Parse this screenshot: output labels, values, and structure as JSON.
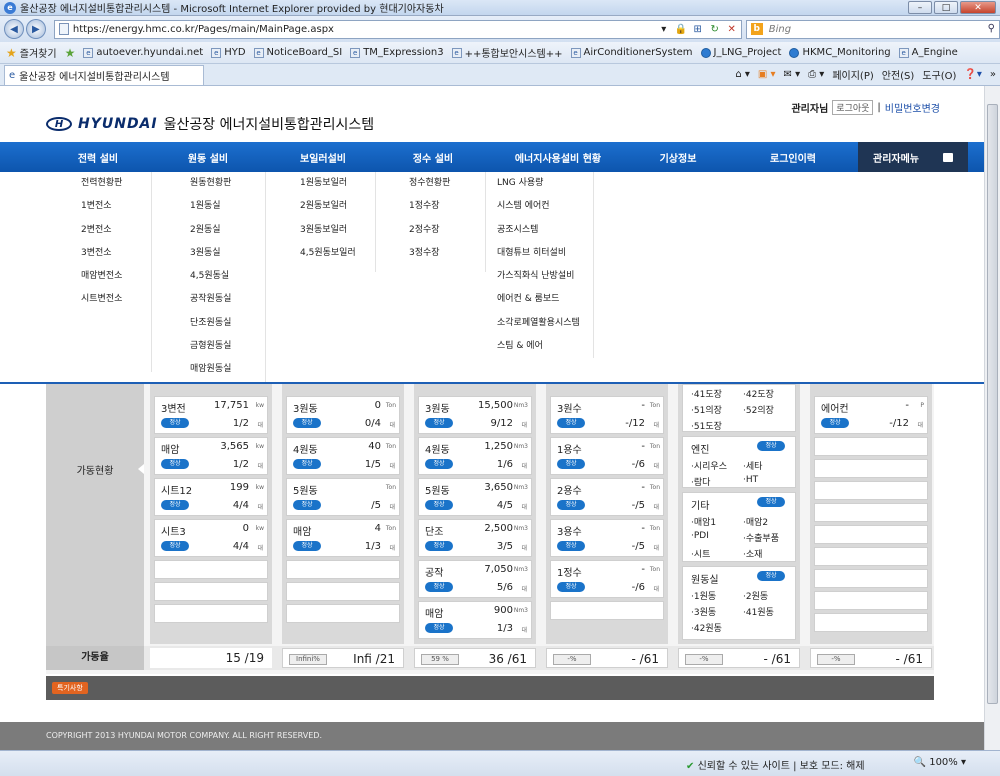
{
  "browser": {
    "title": "울산공장 에너지설비통합관리시스템 - Microsoft Internet Explorer provided by 현대기아자동차",
    "url": "https://energy.hmc.co.kr/Pages/main/MainPage.aspx",
    "search_placeholder": "Bing",
    "favorites_label": "즐겨찾기",
    "favorites": [
      "autoever.hyundai.net",
      "HYD",
      "NoticeBoard_SI",
      "TM_Expression3",
      "++통합보안시스템++",
      "AirConditionerSystem",
      "J_LNG_Project",
      "HKMC_Monitoring",
      "A_Engine"
    ],
    "tab_title": "울산공장 에너지설비통합관리시스템",
    "cmd": {
      "page": "페이지(P)",
      "safety": "안전(S)",
      "tools": "도구(O)"
    },
    "status_text": "신뢰할 수 있는 사이트 | 보호 모드: 해제",
    "zoom": "100%"
  },
  "header": {
    "brand": "HYUNDAI",
    "system_name": "울산공장 에너지설비통합관리시스템",
    "user": "관리자님",
    "logout": "로그아웃",
    "change_pw": "비밀번호변경"
  },
  "menu": [
    "전력 설비",
    "원동 설비",
    "보일러설비",
    "정수 설비",
    "에너지사용설비 현황",
    "기상정보",
    "로그인이력",
    "관리자메뉴"
  ],
  "dropdown": [
    [
      "전력현황판",
      "1변전소",
      "2변전소",
      "3변전소",
      "매암변전소",
      "시트변전소"
    ],
    [
      "원동현황판",
      "1원동실",
      "2원동실",
      "3원동실",
      "4,5원동실",
      "공작원동실",
      "단조원동실",
      "금형원동실",
      "매암원동실"
    ],
    [
      "1원동보일러",
      "2원동보일러",
      "3원동보일러",
      "4,5원동보일러"
    ],
    [
      "정수현황판",
      "1정수장",
      "2정수장",
      "3정수장"
    ],
    [
      "LNG 사용량",
      "시스템 에어컨",
      "공조시스템",
      "대형튜브 히터설비",
      "가스직화식 난방설비",
      "에어컨 & 룸보드",
      "소각로폐열활용시스템",
      "스팀 & 에어"
    ]
  ],
  "status_badge": "정상",
  "unit_count": "대",
  "dashboard": {
    "side_label": "가동현황",
    "rate_label": "가동율",
    "col1": [
      {
        "name": "3변전",
        "value": "17,751",
        "unit": "kw",
        "count": "1/2"
      },
      {
        "name": "매암",
        "value": "3,565",
        "unit": "kw",
        "count": "1/2"
      },
      {
        "name": "시트12",
        "value": "199",
        "unit": "kw",
        "count": "4/4"
      },
      {
        "name": "시트3",
        "value": "0",
        "unit": "kw",
        "count": "4/4"
      }
    ],
    "col2": [
      {
        "name": "3원동",
        "value": "0",
        "unit": "Ton",
        "count": "0/4"
      },
      {
        "name": "4원동",
        "value": "40",
        "unit": "Ton",
        "count": "1/5"
      },
      {
        "name": "5원동",
        "value": "",
        "unit": "Ton",
        "count": "/5"
      },
      {
        "name": "매암",
        "value": "4",
        "unit": "Ton",
        "count": "1/3"
      }
    ],
    "col3": [
      {
        "name": "3원동",
        "value": "15,500",
        "unit": "Nm3",
        "count": "9/12"
      },
      {
        "name": "4원동",
        "value": "1,250",
        "unit": "Nm3",
        "count": "1/6"
      },
      {
        "name": "5원동",
        "value": "3,650",
        "unit": "Nm3",
        "count": "4/5"
      },
      {
        "name": "단조",
        "value": "2,500",
        "unit": "Nm3",
        "count": "3/5"
      },
      {
        "name": "공작",
        "value": "7,050",
        "unit": "Nm3",
        "count": "5/6"
      },
      {
        "name": "매암",
        "value": "900",
        "unit": "Nm3",
        "count": "1/3"
      }
    ],
    "col4": [
      {
        "name": "3원수",
        "value": "-",
        "unit": "Ton",
        "count": "-/12"
      },
      {
        "name": "1용수",
        "value": "-",
        "unit": "Ton",
        "count": "-/6"
      },
      {
        "name": "2용수",
        "value": "-",
        "unit": "Ton",
        "count": "-/5"
      },
      {
        "name": "3용수",
        "value": "-",
        "unit": "Ton",
        "count": "-/5"
      },
      {
        "name": "1정수",
        "value": "-",
        "unit": "Ton",
        "count": "-/6"
      }
    ],
    "col5": {
      "top": [
        "·41도장",
        "·42도장",
        "·51의장",
        "·52의장",
        "·51도장"
      ],
      "engine": {
        "title": "엔진",
        "items": [
          "·시리우스",
          "·세타",
          "·람다",
          "·HT"
        ]
      },
      "etc": {
        "title": "기타",
        "items": [
          "·매암1",
          "·매암2",
          "·PDI",
          "·수출부품",
          "·시트",
          "·소재"
        ]
      },
      "room": {
        "title": "원동실",
        "items": [
          "·1원동",
          "·2원동",
          "·3원동",
          "·41원동",
          "·42원동"
        ]
      }
    },
    "col6": [
      {
        "name": "에어컨",
        "value": "-",
        "unit": "P",
        "count": "-/12"
      }
    ],
    "rates": [
      {
        "pct": "",
        "value": "15 /19"
      },
      {
        "pct": "Infini%",
        "value": "Infi /21"
      },
      {
        "pct": "59 %",
        "value": "36 /61"
      },
      {
        "pct": "-%",
        "value": "- /61"
      },
      {
        "pct": "-%",
        "value": "- /61"
      },
      {
        "pct": "-%",
        "value": "- /61"
      }
    ]
  },
  "special_label": "특기사항",
  "footer": "COPYRIGHT 2013 HYUNDAI MOTOR COMPANY. ALL RIGHT RESERVED."
}
